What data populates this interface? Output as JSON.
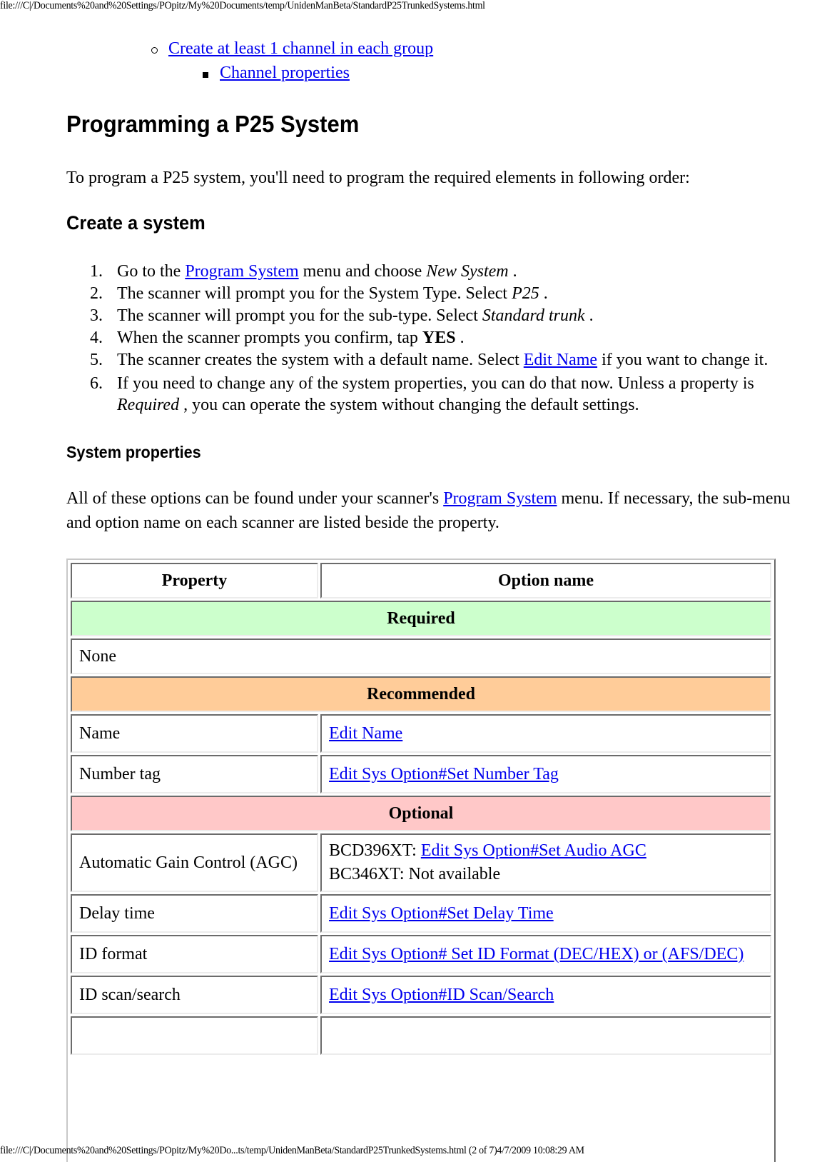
{
  "header": {
    "url": "file:///C|/Documents%20and%20Settings/POpitz/My%20Documents/temp/UnidenManBeta/StandardP25TrunkedSystems.html"
  },
  "sublist": {
    "item1": "Create at least 1 channel in each group",
    "item2": "Channel properties"
  },
  "page_title": "Programming a P25 System",
  "intro": "To program a P25 system, you'll need to program the required elements in following order:",
  "create_system": {
    "heading": "Create a system",
    "steps": [
      {
        "num": "1.",
        "pre": "Go to the ",
        "link": "Program System",
        "mid": " menu and choose ",
        "em": "New System",
        "post": " ."
      },
      {
        "num": "2.",
        "pre": "The scanner will prompt you for the System Type. Select ",
        "em": "P25",
        "post": " ."
      },
      {
        "num": "3.",
        "pre": "The scanner will prompt you for the sub-type. Select ",
        "em": "Standard trunk",
        "post": " ."
      },
      {
        "num": "4.",
        "pre": "When the scanner prompts you confirm, tap ",
        "strong": "YES",
        "post": " ."
      },
      {
        "num": "5.",
        "pre": "The scanner creates the system with a default name. Select ",
        "link": "Edit Name",
        "post": " if you want to change it."
      },
      {
        "num": "6.",
        "pre": "If you need to change any of the system properties, you can do that now. Unless a property is ",
        "em": "Required",
        "post": " , you can operate the system without changing the default settings."
      }
    ]
  },
  "system_properties": {
    "heading": "System properties",
    "intro_pre": "All of these options can be found under your scanner's ",
    "intro_link": "Program System",
    "intro_post": " menu. If necessary, the sub-menu and option name on each scanner are listed beside the property."
  },
  "table": {
    "headers": [
      "Property",
      "Option name"
    ],
    "sections": {
      "required": {
        "label": "Required",
        "color": "#ccffcc",
        "none": "None"
      },
      "recommended": {
        "label": "Recommended",
        "color": "#ffcc99"
      },
      "optional": {
        "label": "Optional",
        "color": "#ffc8c8"
      }
    },
    "rows": {
      "name": {
        "property": "Name",
        "option": "Edit Name"
      },
      "number_tag": {
        "property": "Number tag",
        "option": "Edit Sys Option#Set Number Tag"
      },
      "agc": {
        "property": "Automatic Gain Control (AGC)",
        "line1_prefix": "BCD396XT: ",
        "line1_link": "Edit Sys Option#Set Audio AGC",
        "line2": "BC346XT: Not available"
      },
      "delay": {
        "property": "Delay time",
        "option": "Edit Sys Option#Set Delay Time"
      },
      "id_format": {
        "property": "ID format",
        "option": "Edit Sys Option# Set ID Format (DEC/HEX) or (AFS/DEC)"
      },
      "id_scan": {
        "property": "ID scan/search",
        "option": "Edit Sys Option#ID Scan/Search"
      }
    }
  },
  "footer": {
    "text": "file:///C|/Documents%20and%20Settings/POpitz/My%20Do...ts/temp/UnidenManBeta/StandardP25TrunkedSystems.html (2 of 7)4/7/2009 10:08:29 AM"
  }
}
